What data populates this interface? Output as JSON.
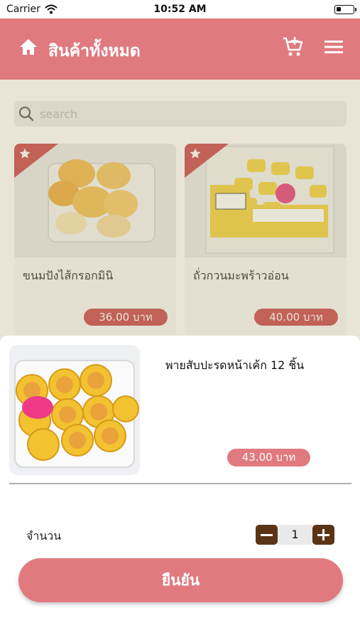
{
  "status_bar": {
    "carrier": "Carrier",
    "time": "10:52 AM"
  },
  "header": {
    "title": "สินค้าทั้งหมด"
  },
  "search": {
    "placeholder": "search"
  },
  "products": [
    {
      "name": "ขนมปังไส้กรอกมินิ",
      "price": "36.00 บาท"
    },
    {
      "name": "ถั่วกวนมะพร้าวอ่อน",
      "price": "40.00 บาท"
    }
  ],
  "detail": {
    "name": "พายสับปะรดหน้าเค้ก 12 ชิ้น",
    "price": "43.00 บาท",
    "quantity_label": "จำนวน",
    "quantity": "1",
    "confirm_label": "ยืนยัน"
  },
  "colors": {
    "header": "#e07a7f",
    "price_badge": "#c8434a",
    "stepper": "#5b3416"
  },
  "icons": [
    "wifi-icon",
    "battery-icon",
    "home-icon",
    "add-to-cart-icon",
    "menu-icon",
    "search-icon",
    "star-icon",
    "minus-icon",
    "plus-icon"
  ]
}
